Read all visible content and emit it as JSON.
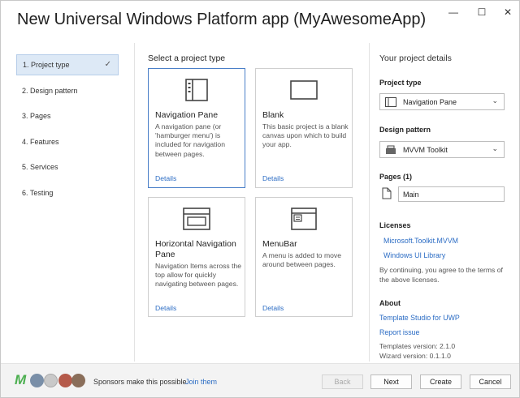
{
  "window": {
    "title": "New Universal Windows Platform app (MyAwesomeApp)",
    "controls": {
      "minimize": "—",
      "maximize": "☐",
      "close": "✕"
    }
  },
  "steps": [
    {
      "label": "1. Project type",
      "active": true
    },
    {
      "label": "2. Design pattern"
    },
    {
      "label": "3. Pages"
    },
    {
      "label": "4. Features"
    },
    {
      "label": "5. Services"
    },
    {
      "label": "6. Testing"
    }
  ],
  "main": {
    "section_title": "Select a project type",
    "cards": [
      {
        "title": "Navigation Pane",
        "desc": "A navigation pane (or 'hamburger menu') is included for navigation between pages.",
        "details": "Details",
        "icon": "navigation-pane-icon"
      },
      {
        "title": "Blank",
        "desc": "This basic project is a blank canvas upon which to build your app.",
        "details": "Details",
        "icon": "blank-icon"
      },
      {
        "title": "Horizontal Navigation Pane",
        "desc": "Navigation Items across the top allow for quickly navigating between pages.",
        "details": "Details",
        "icon": "horizontal-navigation-icon"
      },
      {
        "title": "MenuBar",
        "desc": "A menu is added to move around between pages.",
        "details": "Details",
        "icon": "menubar-icon"
      }
    ]
  },
  "details": {
    "title": "Your project details",
    "project_type_label": "Project type",
    "project_type_value": "Navigation Pane",
    "design_pattern_label": "Design pattern",
    "design_pattern_value": "MVVM Toolkit",
    "pages_label": "Pages (1)",
    "page_name": "Main",
    "licenses_label": "Licenses",
    "license_1": "Microsoft.Toolkit.MVVM",
    "license_2": "Windows UI Library",
    "license_note_1": "By continuing, you agree to the terms of",
    "license_note_2": "the above licenses.",
    "about_label": "About",
    "about_link": "Template Studio for UWP",
    "report_link": "Report issue",
    "templates_version": "Templates version: 2.1.0",
    "wizard_version": "Wizard version: 0.1.1.0"
  },
  "footer": {
    "sponsors_text": "Sponsors make this possible.",
    "join_link": "Join them",
    "back": "Back",
    "next": "Next",
    "create": "Create",
    "cancel": "Cancel",
    "logo_letter": "M"
  },
  "colors": {
    "accent": "#2b6cc4",
    "selected_border": "#4a7fc8",
    "active_step": "#dde9f6"
  }
}
